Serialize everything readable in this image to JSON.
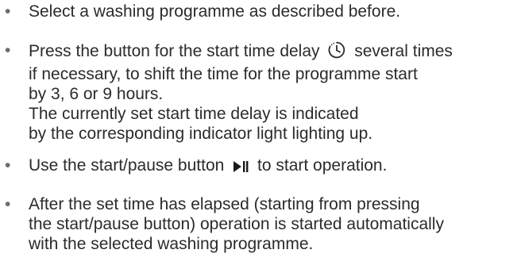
{
  "steps": [
    {
      "lines": [
        "Select a washing programme as described before."
      ]
    },
    {
      "line1_before": "Press the button for the start time delay",
      "line1_icon": "clock-icon",
      "line1_after": "several times",
      "lines": [
        "if necessary, to shift the time for the programme start",
        "by 3, 6 or 9 hours.",
        "The currently set start time delay is indicated",
        "by the corresponding indicator light lighting up."
      ]
    },
    {
      "before": "Use the start/pause button",
      "icon": "play-pause-icon",
      "after": "to start operation."
    },
    {
      "lines": [
        "After the set time has elapsed (starting from pressing",
        "the start/pause button) operation is started automatically",
        "with the selected washing programme."
      ]
    }
  ],
  "bullet": "•"
}
